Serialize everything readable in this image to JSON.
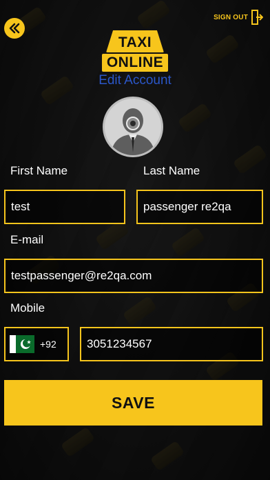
{
  "header": {
    "back_icon": "double-chevron-left-icon",
    "signout_label": "SIGN OUT",
    "signout_icon": "exit-door-icon",
    "logo_top": "TAXI",
    "logo_bottom": "ONLINE",
    "page_title": "Edit Account"
  },
  "avatar": {
    "icon": "user-camera-avatar-icon"
  },
  "form": {
    "first_name_label": "First Name",
    "first_name_value": "test",
    "last_name_label": "Last Name",
    "last_name_value": "passenger re2qa",
    "email_label": "E-mail",
    "email_value": "testpassenger@re2qa.com",
    "mobile_label": "Mobile",
    "country_flag": "pakistan-flag-icon",
    "dial_code": "+92",
    "mobile_value": "3051234567"
  },
  "save_label": "SAVE",
  "colors": {
    "accent": "#f7c51c",
    "title_blue": "#2b57c9"
  }
}
